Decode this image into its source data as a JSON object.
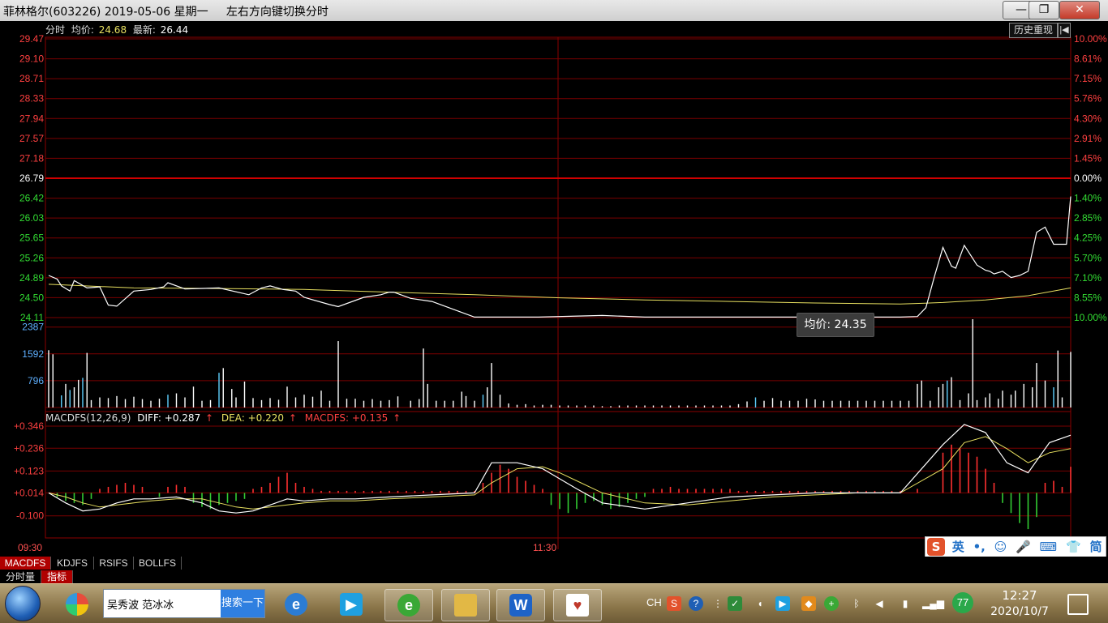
{
  "window": {
    "title": "菲林格尔(603226) 2019-05-06 星期一     左右方向键切换分时",
    "buttons": {
      "minimize": "—",
      "maximize": "❐",
      "close": "✕"
    }
  },
  "header": {
    "mode_label": "分时",
    "avg_label": "均价:",
    "avg_value": "24.68",
    "last_label": "最新:",
    "last_value": "26.44",
    "history_button": "历史重现",
    "history_arrow": "|◀"
  },
  "price_axis": {
    "left_labels": [
      "29.47",
      "29.10",
      "28.71",
      "28.33",
      "27.94",
      "27.57",
      "27.18",
      "26.79",
      "26.42",
      "26.03",
      "25.65",
      "25.26",
      "24.89",
      "24.50",
      "24.11"
    ],
    "right_labels": [
      "10.00%",
      "8.61%",
      "7.15%",
      "5.76%",
      "4.30%",
      "2.91%",
      "1.45%",
      "0.00%",
      "1.40%",
      "2.85%",
      "4.25%",
      "5.70%",
      "7.10%",
      "8.55%",
      "10.00%"
    ],
    "prev_close": 26.79,
    "ylim": [
      24.11,
      29.47
    ]
  },
  "volume_axis": {
    "labels": [
      "2387",
      "1592",
      "796"
    ],
    "ylim": [
      0,
      2620
    ]
  },
  "macd": {
    "header_name": "MACDFS(12,26,9)",
    "diff_label": "DIFF: +0.287",
    "dea_label": "DEA: +0.220",
    "macdfs_label": "MACDFS: +0.135",
    "up_arrow": "↑",
    "axis_labels": [
      "+0.346",
      "+0.236",
      "+0.123",
      "+0.014",
      "-0.100"
    ],
    "ylim": [
      -0.21,
      0.346
    ]
  },
  "time_axis": {
    "start": "09:30",
    "mid": "11:30"
  },
  "tooltip": {
    "label": "均价:",
    "value": "24.35"
  },
  "chart_data": {
    "type": "line",
    "x_range": [
      0,
      240
    ],
    "price": {
      "name": "最新",
      "x": [
        0,
        2,
        3,
        5,
        6,
        9,
        12,
        14,
        16,
        20,
        24,
        27,
        28,
        32,
        40,
        47,
        50,
        52,
        55,
        58,
        60,
        66,
        68,
        74,
        78,
        80,
        81,
        85,
        90,
        100,
        102,
        105,
        110,
        115,
        130,
        140,
        150,
        165,
        175,
        185,
        200,
        210,
        220,
        230,
        235,
        240
      ],
      "y": [
        24.92,
        24.85,
        24.72,
        24.62,
        24.82,
        24.68,
        24.7,
        24.35,
        24.33,
        24.62,
        24.65,
        24.7,
        24.78,
        24.66,
        24.68,
        24.55,
        24.68,
        24.72,
        24.65,
        24.62,
        24.5,
        24.36,
        24.32,
        24.5,
        24.55,
        24.6,
        24.6,
        24.48,
        24.42,
        24.12,
        24.12,
        24.12,
        24.12,
        24.12,
        24.15,
        24.12,
        24.12,
        24.12,
        24.12,
        24.12,
        24.12,
        24.12,
        24.12,
        24.12,
        24.15,
        24.14
      ]
    },
    "avg_price": {
      "name": "均价",
      "x": [
        0,
        20,
        40,
        60,
        80,
        100,
        120,
        140,
        160,
        180,
        200,
        220,
        240
      ],
      "y": [
        24.75,
        24.68,
        24.67,
        24.65,
        24.6,
        24.55,
        24.49,
        24.45,
        24.42,
        24.39,
        24.37,
        24.36,
        24.35
      ]
    },
    "price_tail": {
      "x": [
        200,
        204,
        206,
        208,
        210,
        212,
        213,
        214,
        215,
        218,
        220,
        221,
        222,
        224,
        226,
        228,
        230,
        232,
        234,
        236,
        238,
        239,
        240
      ],
      "y": [
        24.12,
        24.13,
        24.3,
        24.9,
        25.46,
        25.1,
        25.06,
        25.28,
        25.5,
        25.12,
        25.02,
        25.0,
        24.95,
        25.0,
        24.88,
        24.92,
        25.0,
        25.75,
        25.85,
        25.52,
        25.52,
        25.52,
        26.44
      ]
    },
    "avg_tail": {
      "x": [
        200,
        210,
        220,
        230,
        240
      ],
      "y": [
        24.37,
        24.4,
        24.45,
        24.53,
        24.68
      ]
    },
    "volume": [
      {
        "x": 0,
        "v": 1700,
        "c": "w"
      },
      {
        "x": 1,
        "v": 1580,
        "c": "w"
      },
      {
        "x": 3,
        "v": 360,
        "c": "b"
      },
      {
        "x": 4,
        "v": 700,
        "c": "w"
      },
      {
        "x": 5,
        "v": 520,
        "c": "b"
      },
      {
        "x": 6,
        "v": 600,
        "c": "w"
      },
      {
        "x": 7,
        "v": 820,
        "c": "w"
      },
      {
        "x": 8,
        "v": 880,
        "c": "b"
      },
      {
        "x": 9,
        "v": 1620,
        "c": "w"
      },
      {
        "x": 10,
        "v": 220,
        "c": "w"
      },
      {
        "x": 12,
        "v": 300,
        "c": "w"
      },
      {
        "x": 14,
        "v": 280,
        "c": "w"
      },
      {
        "x": 16,
        "v": 340,
        "c": "w"
      },
      {
        "x": 18,
        "v": 250,
        "c": "w"
      },
      {
        "x": 20,
        "v": 320,
        "c": "w"
      },
      {
        "x": 22,
        "v": 250,
        "c": "w"
      },
      {
        "x": 24,
        "v": 200,
        "c": "w"
      },
      {
        "x": 26,
        "v": 260,
        "c": "w"
      },
      {
        "x": 28,
        "v": 380,
        "c": "b"
      },
      {
        "x": 30,
        "v": 420,
        "c": "w"
      },
      {
        "x": 32,
        "v": 300,
        "c": "w"
      },
      {
        "x": 34,
        "v": 620,
        "c": "w"
      },
      {
        "x": 36,
        "v": 200,
        "c": "w"
      },
      {
        "x": 38,
        "v": 220,
        "c": "w"
      },
      {
        "x": 40,
        "v": 1030,
        "c": "b"
      },
      {
        "x": 41,
        "v": 1170,
        "c": "w"
      },
      {
        "x": 43,
        "v": 550,
        "c": "w"
      },
      {
        "x": 44,
        "v": 300,
        "c": "w"
      },
      {
        "x": 46,
        "v": 770,
        "c": "w"
      },
      {
        "x": 48,
        "v": 280,
        "c": "w"
      },
      {
        "x": 50,
        "v": 220,
        "c": "w"
      },
      {
        "x": 52,
        "v": 280,
        "c": "w"
      },
      {
        "x": 54,
        "v": 230,
        "c": "w"
      },
      {
        "x": 56,
        "v": 620,
        "c": "w"
      },
      {
        "x": 58,
        "v": 300,
        "c": "w"
      },
      {
        "x": 60,
        "v": 380,
        "c": "w"
      },
      {
        "x": 62,
        "v": 320,
        "c": "w"
      },
      {
        "x": 64,
        "v": 500,
        "c": "w"
      },
      {
        "x": 66,
        "v": 200,
        "c": "w"
      },
      {
        "x": 68,
        "v": 1970,
        "c": "w"
      },
      {
        "x": 70,
        "v": 260,
        "c": "w"
      },
      {
        "x": 72,
        "v": 260,
        "c": "w"
      },
      {
        "x": 74,
        "v": 200,
        "c": "w"
      },
      {
        "x": 76,
        "v": 250,
        "c": "w"
      },
      {
        "x": 78,
        "v": 200,
        "c": "w"
      },
      {
        "x": 80,
        "v": 220,
        "c": "w"
      },
      {
        "x": 82,
        "v": 330,
        "c": "w"
      },
      {
        "x": 85,
        "v": 200,
        "c": "w"
      },
      {
        "x": 87,
        "v": 250,
        "c": "w"
      },
      {
        "x": 88,
        "v": 1750,
        "c": "w"
      },
      {
        "x": 89,
        "v": 700,
        "c": "w"
      },
      {
        "x": 91,
        "v": 200,
        "c": "w"
      },
      {
        "x": 93,
        "v": 200,
        "c": "w"
      },
      {
        "x": 95,
        "v": 200,
        "c": "w"
      },
      {
        "x": 97,
        "v": 470,
        "c": "w"
      },
      {
        "x": 98,
        "v": 340,
        "c": "w"
      },
      {
        "x": 100,
        "v": 200,
        "c": "w"
      },
      {
        "x": 102,
        "v": 380,
        "c": "b"
      },
      {
        "x": 103,
        "v": 600,
        "c": "w"
      },
      {
        "x": 104,
        "v": 1320,
        "c": "w"
      },
      {
        "x": 106,
        "v": 380,
        "c": "w"
      },
      {
        "x": 108,
        "v": 120,
        "c": "w"
      },
      {
        "x": 110,
        "v": 80,
        "c": "w"
      },
      {
        "x": 112,
        "v": 100,
        "c": "w"
      },
      {
        "x": 114,
        "v": 60,
        "c": "w"
      },
      {
        "x": 116,
        "v": 80,
        "c": "w"
      },
      {
        "x": 118,
        "v": 80,
        "c": "w"
      },
      {
        "x": 120,
        "v": 60,
        "c": "w"
      },
      {
        "x": 122,
        "v": 60,
        "c": "w"
      },
      {
        "x": 124,
        "v": 60,
        "c": "w"
      },
      {
        "x": 126,
        "v": 60,
        "c": "w"
      },
      {
        "x": 128,
        "v": 60,
        "c": "w"
      },
      {
        "x": 130,
        "v": 40,
        "c": "w"
      },
      {
        "x": 132,
        "v": 40,
        "c": "w"
      },
      {
        "x": 134,
        "v": 60,
        "c": "w"
      },
      {
        "x": 136,
        "v": 60,
        "c": "w"
      },
      {
        "x": 138,
        "v": 60,
        "c": "w"
      },
      {
        "x": 140,
        "v": 60,
        "c": "w"
      },
      {
        "x": 142,
        "v": 60,
        "c": "w"
      },
      {
        "x": 144,
        "v": 60,
        "c": "w"
      },
      {
        "x": 146,
        "v": 60,
        "c": "w"
      },
      {
        "x": 148,
        "v": 60,
        "c": "w"
      },
      {
        "x": 150,
        "v": 60,
        "c": "w"
      },
      {
        "x": 152,
        "v": 60,
        "c": "w"
      },
      {
        "x": 154,
        "v": 60,
        "c": "w"
      },
      {
        "x": 156,
        "v": 60,
        "c": "w"
      },
      {
        "x": 158,
        "v": 60,
        "c": "w"
      },
      {
        "x": 160,
        "v": 60,
        "c": "w"
      },
      {
        "x": 162,
        "v": 100,
        "c": "w"
      },
      {
        "x": 164,
        "v": 180,
        "c": "w"
      },
      {
        "x": 166,
        "v": 300,
        "c": "b"
      },
      {
        "x": 168,
        "v": 200,
        "c": "w"
      },
      {
        "x": 170,
        "v": 280,
        "c": "w"
      },
      {
        "x": 172,
        "v": 200,
        "c": "w"
      },
      {
        "x": 174,
        "v": 200,
        "c": "w"
      },
      {
        "x": 176,
        "v": 200,
        "c": "w"
      },
      {
        "x": 178,
        "v": 260,
        "c": "w"
      },
      {
        "x": 180,
        "v": 240,
        "c": "w"
      },
      {
        "x": 182,
        "v": 200,
        "c": "w"
      },
      {
        "x": 184,
        "v": 200,
        "c": "w"
      },
      {
        "x": 186,
        "v": 200,
        "c": "w"
      },
      {
        "x": 188,
        "v": 200,
        "c": "w"
      },
      {
        "x": 190,
        "v": 200,
        "c": "w"
      },
      {
        "x": 192,
        "v": 200,
        "c": "w"
      },
      {
        "x": 194,
        "v": 200,
        "c": "w"
      },
      {
        "x": 196,
        "v": 200,
        "c": "w"
      },
      {
        "x": 198,
        "v": 200,
        "c": "w"
      },
      {
        "x": 200,
        "v": 200,
        "c": "w"
      },
      {
        "x": 202,
        "v": 200,
        "c": "w"
      },
      {
        "x": 204,
        "v": 700,
        "c": "w"
      },
      {
        "x": 205,
        "v": 800,
        "c": "w"
      },
      {
        "x": 207,
        "v": 200,
        "c": "w"
      },
      {
        "x": 209,
        "v": 600,
        "c": "w"
      },
      {
        "x": 210,
        "v": 700,
        "c": "w"
      },
      {
        "x": 211,
        "v": 800,
        "c": "b"
      },
      {
        "x": 212,
        "v": 900,
        "c": "w"
      },
      {
        "x": 214,
        "v": 220,
        "c": "w"
      },
      {
        "x": 216,
        "v": 420,
        "c": "w"
      },
      {
        "x": 217,
        "v": 2620,
        "c": "w"
      },
      {
        "x": 218,
        "v": 220,
        "c": "w"
      },
      {
        "x": 220,
        "v": 300,
        "c": "w"
      },
      {
        "x": 221,
        "v": 420,
        "c": "w"
      },
      {
        "x": 223,
        "v": 260,
        "c": "w"
      },
      {
        "x": 224,
        "v": 500,
        "c": "w"
      },
      {
        "x": 226,
        "v": 380,
        "c": "w"
      },
      {
        "x": 227,
        "v": 500,
        "c": "w"
      },
      {
        "x": 229,
        "v": 700,
        "c": "w"
      },
      {
        "x": 231,
        "v": 600,
        "c": "w"
      },
      {
        "x": 232,
        "v": 1320,
        "c": "w"
      },
      {
        "x": 234,
        "v": 800,
        "c": "w"
      },
      {
        "x": 236,
        "v": 600,
        "c": "b"
      },
      {
        "x": 237,
        "v": 1690,
        "c": "w"
      },
      {
        "x": 238,
        "v": 300,
        "c": "w"
      },
      {
        "x": 240,
        "v": 1650,
        "c": "w"
      }
    ],
    "macd_diff": {
      "x": [
        0,
        4,
        8,
        12,
        16,
        20,
        24,
        30,
        36,
        40,
        44,
        48,
        52,
        56,
        60,
        66,
        72,
        80,
        90,
        100,
        104,
        110,
        116,
        120,
        124,
        130,
        140,
        150,
        160,
        170,
        180,
        190,
        200,
        210,
        215,
        220,
        225,
        230,
        235,
        240
      ],
      "y": [
        0.0,
        -0.05,
        -0.09,
        -0.08,
        -0.05,
        -0.03,
        -0.03,
        -0.02,
        -0.05,
        -0.09,
        -0.1,
        -0.09,
        -0.06,
        -0.03,
        -0.04,
        -0.03,
        -0.03,
        -0.02,
        -0.01,
        0.0,
        0.15,
        0.15,
        0.12,
        0.07,
        0.02,
        -0.05,
        -0.08,
        -0.05,
        -0.02,
        -0.01,
        0.0,
        0.0,
        0.0,
        0.24,
        0.34,
        0.3,
        0.15,
        0.1,
        0.25,
        0.287
      ]
    },
    "macd_dea": {
      "x": [
        0,
        4,
        8,
        12,
        16,
        20,
        24,
        30,
        36,
        40,
        44,
        48,
        52,
        56,
        60,
        66,
        72,
        80,
        90,
        100,
        104,
        110,
        116,
        120,
        124,
        130,
        140,
        150,
        160,
        170,
        180,
        190,
        200,
        210,
        215,
        220,
        225,
        230,
        235,
        240
      ],
      "y": [
        0.0,
        -0.02,
        -0.05,
        -0.07,
        -0.06,
        -0.05,
        -0.04,
        -0.03,
        -0.03,
        -0.05,
        -0.07,
        -0.08,
        -0.07,
        -0.06,
        -0.05,
        -0.04,
        -0.04,
        -0.03,
        -0.02,
        -0.01,
        0.05,
        0.12,
        0.13,
        0.1,
        0.06,
        0.0,
        -0.05,
        -0.06,
        -0.04,
        -0.02,
        -0.01,
        0.0,
        0.0,
        0.12,
        0.25,
        0.28,
        0.22,
        0.15,
        0.2,
        0.22
      ]
    },
    "macd_hist": {
      "x": [
        2,
        4,
        6,
        8,
        10,
        12,
        14,
        16,
        18,
        20,
        22,
        24,
        26,
        28,
        30,
        32,
        34,
        36,
        38,
        40,
        42,
        44,
        46,
        48,
        50,
        52,
        54,
        56,
        58,
        60,
        62,
        64,
        66,
        68,
        70,
        72,
        74,
        76,
        78,
        80,
        82,
        84,
        86,
        88,
        90,
        92,
        94,
        96,
        98,
        100,
        102,
        104,
        106,
        108,
        110,
        112,
        114,
        116,
        118,
        120,
        122,
        124,
        126,
        128,
        130,
        132,
        134,
        136,
        138,
        140,
        142,
        144,
        146,
        148,
        150,
        152,
        154,
        156,
        158,
        160,
        162,
        164,
        166,
        168,
        170,
        172,
        174,
        176,
        178,
        180,
        182,
        184,
        186,
        188,
        190,
        192,
        194,
        196,
        198,
        200,
        202,
        204,
        206,
        208,
        210,
        212,
        214,
        216,
        218,
        220,
        222,
        224,
        226,
        228,
        230,
        232,
        234,
        236,
        238,
        240
      ],
      "y": [
        -0.02,
        -0.04,
        -0.05,
        -0.06,
        -0.03,
        0.02,
        0.03,
        0.04,
        0.05,
        0.04,
        0.03,
        0.0,
        -0.02,
        0.03,
        0.04,
        0.03,
        -0.05,
        -0.07,
        -0.08,
        -0.06,
        -0.05,
        -0.04,
        -0.03,
        0.02,
        0.03,
        0.05,
        0.08,
        0.1,
        0.05,
        0.03,
        0.02,
        0.01,
        0.01,
        0.01,
        0.01,
        0.01,
        0.01,
        0.01,
        0.01,
        0.01,
        0.01,
        0.01,
        0.01,
        0.01,
        0.01,
        0.01,
        0.01,
        0.01,
        0.01,
        0.01,
        0.05,
        0.1,
        0.14,
        0.12,
        0.08,
        0.06,
        0.04,
        0.02,
        -0.06,
        -0.08,
        -0.1,
        -0.08,
        -0.05,
        -0.04,
        -0.06,
        -0.08,
        -0.07,
        -0.05,
        -0.03,
        -0.02,
        0.02,
        0.02,
        0.03,
        0.02,
        0.02,
        0.02,
        0.02,
        0.02,
        0.02,
        0.02,
        0.01,
        0.01,
        0.01,
        0.01,
        0.01,
        0.01,
        0.01,
        0.01,
        0.01,
        0.01,
        0.01,
        0.01,
        0.01,
        0.01,
        0.01,
        0.01,
        0.01,
        0.01,
        0.01,
        0.01,
        0.0,
        0.02,
        0.0,
        0.0,
        0.2,
        0.24,
        0.22,
        0.2,
        0.18,
        0.12,
        0.05,
        -0.05,
        -0.1,
        -0.15,
        -0.18,
        -0.12,
        0.05,
        0.06,
        0.03,
        0.13
      ]
    }
  },
  "ime_bar": {
    "logo": "S",
    "lang": "英",
    "icons": [
      "•,",
      "☺",
      "🎤",
      "⌨",
      "👕",
      "简",
      "⌂"
    ]
  },
  "tabs": [
    "MACDFS",
    "KDJFS",
    "RSIFS",
    "BOLLFS"
  ],
  "bottom_tabs": [
    "分时量",
    "指标"
  ],
  "taskbar": {
    "search_placeholder": "吴秀波 范冰冰",
    "search_button": "搜索一下",
    "lang": "CH",
    "tray_badge": "77",
    "clock_time": "12:27",
    "clock_date": "2020/10/7",
    "colors": {
      "ie": "#2b7cd3",
      "bilibili": "#1fa0e0",
      "green_e": "#3aa836",
      "folder": "#e2b845",
      "wps": "#1e63c7",
      "solitaire": "#c0392b"
    }
  }
}
